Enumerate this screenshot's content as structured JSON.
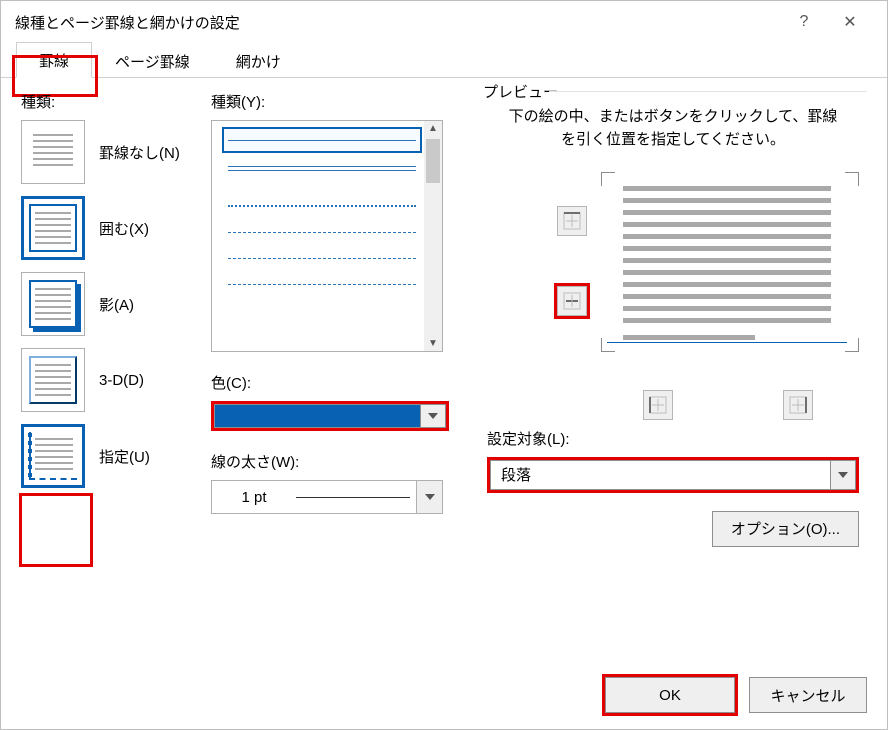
{
  "title": "線種とページ罫線と網かけの設定",
  "tabs": [
    "罫線",
    "ページ罫線",
    "網かけ"
  ],
  "active_tab": 0,
  "col1": {
    "label": "種類:",
    "settings": [
      {
        "label": "罫線なし(N)",
        "key": "N"
      },
      {
        "label": "囲む(X)",
        "key": "X"
      },
      {
        "label": "影(A)",
        "key": "A"
      },
      {
        "label": "3-D(D)",
        "key": "D"
      },
      {
        "label": "指定(U)",
        "key": "U"
      }
    ],
    "selected": 4
  },
  "col2": {
    "style_label": "種類(Y):",
    "color_label": "色(C):",
    "color_value": "#0861b3",
    "width_label": "線の太さ(W):",
    "width_value": "1 pt"
  },
  "col3": {
    "preview_label": "プレビュー",
    "hint": "下の絵の中、またはボタンをクリックして、罫線を引く位置を指定してください。",
    "apply_label": "設定対象(L):",
    "apply_value": "段落",
    "options_label": "オプション(O)..."
  },
  "footer": {
    "ok": "OK",
    "cancel": "キャンセル"
  }
}
